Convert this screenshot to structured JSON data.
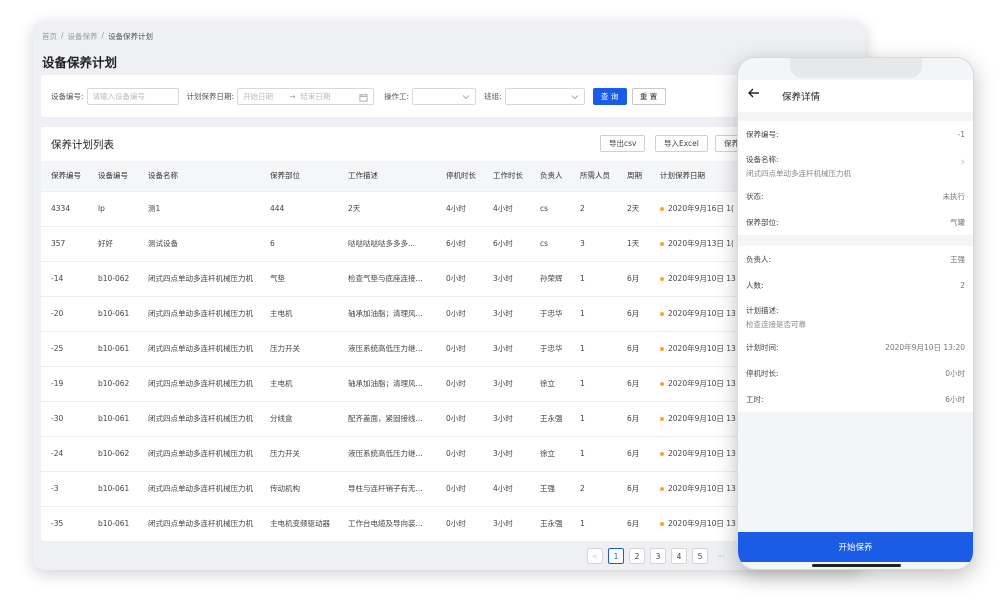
{
  "breadcrumb": [
    "首页",
    "/",
    "设备保养",
    "/",
    "设备保养计划"
  ],
  "page_title": "设备保养计划",
  "filters": {
    "device_no_label": "设备编号:",
    "device_no_placeholder": "请输入设备编号",
    "date_label": "计划保养日期:",
    "date_start_placeholder": "开始日期",
    "date_arrow": "→",
    "date_end_placeholder": "结束日期",
    "operator_label": "操作工:",
    "team_label": "班组:",
    "query_button": "查 询",
    "reset_button": "重 置"
  },
  "list": {
    "title": "保养计划列表",
    "export_csv": "导出csv",
    "import_excel": "导入Excel",
    "third_button": "保养",
    "columns": [
      "保养编号",
      "设备编号",
      "设备名称",
      "保养部位",
      "工作描述",
      "停机时长",
      "工作时长",
      "负责人",
      "所需人员",
      "周期",
      "计划保养日期"
    ],
    "rows": [
      [
        "4334",
        "lp",
        "测1",
        "444",
        "2天",
        "4小时",
        "4小时",
        "cs",
        "2",
        "2天",
        "2020年9月16日 1("
      ],
      [
        "357",
        "好好",
        "测试设备",
        "6",
        "哒哒哒哒哒多多多...",
        "6小时",
        "6小时",
        "cs",
        "3",
        "1天",
        "2020年9月13日 1("
      ],
      [
        "-14",
        "b10-062",
        "闭式四点单动多连杆机械压力机",
        "气垫",
        "检查气垫与底座连接...",
        "0小时",
        "3小时",
        "孙荣辉",
        "1",
        "6月",
        "2020年9月10日 13"
      ],
      [
        "-20",
        "b10-061",
        "闭式四点单动多连杆机械压力机",
        "主电机",
        "轴承加油脂；清理风...",
        "0小时",
        "3小时",
        "于忠华",
        "1",
        "6月",
        "2020年9月10日 13"
      ],
      [
        "-25",
        "b10-061",
        "闭式四点单动多连杆机械压力机",
        "压力开关",
        "液压系统高低压力继...",
        "0小时",
        "3小时",
        "于忠华",
        "1",
        "6月",
        "2020年9月10日 13"
      ],
      [
        "-19",
        "b10-062",
        "闭式四点单动多连杆机械压力机",
        "主电机",
        "轴承加油脂；清理风...",
        "0小时",
        "3小时",
        "徐立",
        "1",
        "6月",
        "2020年9月10日 13"
      ],
      [
        "-30",
        "b10-061",
        "闭式四点单动多连杆机械压力机",
        "分线盒",
        "配齐盖面，紧固接线...",
        "0小时",
        "3小时",
        "王永强",
        "1",
        "6月",
        "2020年9月10日 13"
      ],
      [
        "-24",
        "b10-062",
        "闭式四点单动多连杆机械压力机",
        "压力开关",
        "液压系统高低压力继...",
        "0小时",
        "3小时",
        "徐立",
        "1",
        "6月",
        "2020年9月10日 13"
      ],
      [
        "-3",
        "b10-061",
        "闭式四点单动多连杆机械压力机",
        "传动机构",
        "导柱与连杆销子有无...",
        "0小时",
        "4小时",
        "王强",
        "2",
        "6月",
        "2020年9月10日 13"
      ],
      [
        "-35",
        "b10-061",
        "闭式四点单动多连杆机械压力机",
        "主电机变频驱动器",
        "工作台电缆及导向装...",
        "0小时",
        "3小时",
        "王永强",
        "1",
        "6月",
        "2020年9月10日 13"
      ]
    ]
  },
  "pagination": {
    "prev": "<",
    "pages": [
      "1",
      "2",
      "3",
      "4",
      "5"
    ],
    "ellipsis": "···",
    "current": "1"
  },
  "mobile": {
    "title": "保养详情",
    "fields": {
      "plan_no_label": "保养编号:",
      "plan_no_value": "-1",
      "device_name_label": "设备名称:",
      "device_name_value": "闭式四点单动多连杆机械压力机",
      "status_label": "状态:",
      "status_value": "未执行",
      "part_label": "保养部位:",
      "part_value": "气罐",
      "owner_label": "负责人:",
      "owner_value": "王强",
      "count_label": "人数:",
      "count_value": "2",
      "desc_label": "计划描述:",
      "desc_value": "检查连接是否可靠",
      "time_label": "计划时间:",
      "time_value": "2020年9月10日 13:20",
      "downtime_label": "停机时长:",
      "downtime_value": "0小时",
      "worktime_label": "工时:",
      "worktime_value": "6小时"
    },
    "start_button": "开始保养"
  },
  "colors": {
    "primary": "#1a5ce6",
    "status_dot": "#f5a623"
  }
}
